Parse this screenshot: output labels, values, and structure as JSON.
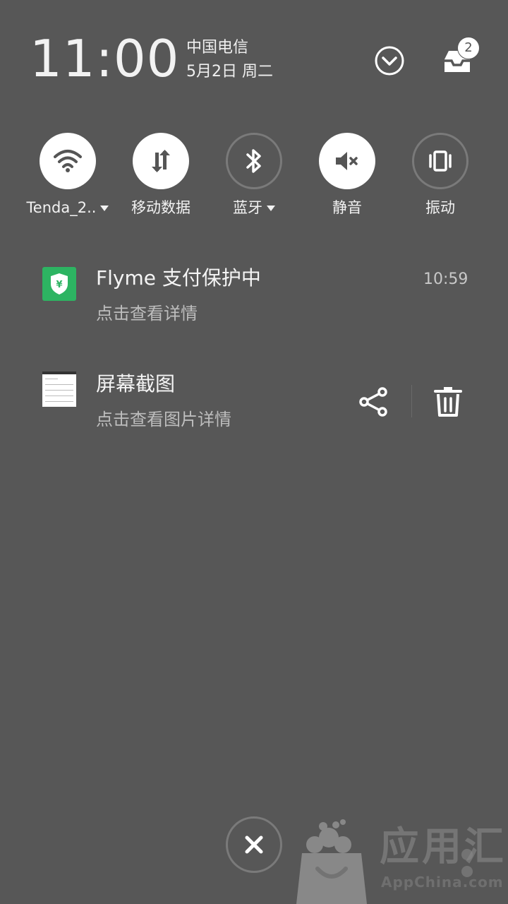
{
  "status": {
    "time": "11:00",
    "carrier": "中国电信",
    "date": "5月2日 周二",
    "inbox_badge": "2"
  },
  "toggles": [
    {
      "label": "Tenda_2..",
      "icon": "wifi-icon",
      "state": "on",
      "has_dropdown": true
    },
    {
      "label": "移动数据",
      "icon": "mobile-data-icon",
      "state": "on",
      "has_dropdown": false
    },
    {
      "label": "蓝牙",
      "icon": "bluetooth-icon",
      "state": "off",
      "has_dropdown": true
    },
    {
      "label": "静音",
      "icon": "mute-icon",
      "state": "on",
      "has_dropdown": false
    },
    {
      "label": "振动",
      "icon": "vibrate-icon",
      "state": "off",
      "has_dropdown": false
    }
  ],
  "notifications": [
    {
      "title": "Flyme 支付保护中",
      "subtitle": "点击查看详情",
      "time": "10:59",
      "icon": "payment-shield-icon"
    },
    {
      "title": "屏幕截图",
      "subtitle": "点击查看图片详情",
      "icon": "screenshot-thumbnail",
      "actions": [
        "share-icon",
        "delete-icon"
      ]
    }
  ],
  "watermark": {
    "text": "应用汇",
    "sub": "AppChina.com"
  },
  "colors": {
    "background": "#575757",
    "toggle_on": "#ffffff",
    "payment_green": "#2db462"
  }
}
